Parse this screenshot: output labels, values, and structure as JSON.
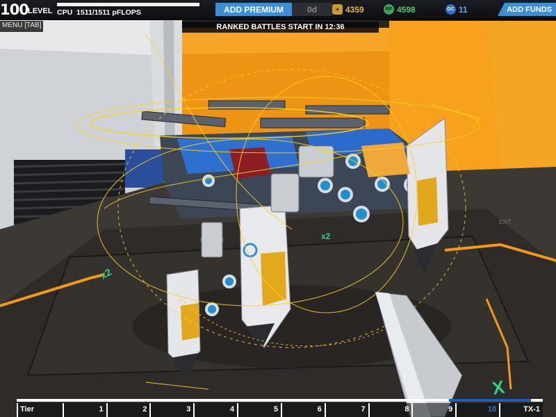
{
  "hud": {
    "level_number": "100",
    "level_label": "LEVEL",
    "cpu_label": "CPU",
    "cpu_value": "1511/1511 pFLOPS",
    "cpu_fill": 1.0,
    "premium_button": "ADD PREMIUM",
    "premium_days": "0d",
    "robits_icon": "robits-icon",
    "robits": "4359",
    "rp_icon": "rp-icon",
    "rp_badge": "RP",
    "rp": "4598",
    "gc_icon": "gc-icon",
    "gc_badge": "GC",
    "gc": "11",
    "funds_button": "ADD FUNDS"
  },
  "menu_tab": "MENU [TAB]",
  "ranked_banner": "RANKED BATTLES START IN 12:36",
  "floor_markers": [
    "x2",
    "x2",
    "X"
  ],
  "exit_sign": "EXIT",
  "tier_bar": {
    "label": "Tier",
    "tiers": [
      "1",
      "2",
      "3",
      "4",
      "5",
      "6",
      "7",
      "8",
      "9",
      "10",
      "TX-1"
    ],
    "current": "10"
  },
  "colors": {
    "accent_blue": "#3a8fd6",
    "robits_gold": "#e9b14a",
    "rp_green": "#4fc76e",
    "gc_blue": "#5aa8ff",
    "wall_orange": "#f29a18",
    "gizmo_yellow": "#ffd21a"
  }
}
